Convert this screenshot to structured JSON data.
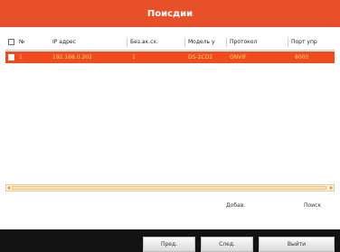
{
  "window": {
    "title": "Поисдии"
  },
  "table": {
    "columns": [
      "№",
      "IP адрес",
      "Без.ак.сх.",
      "Модель у",
      "Протокол",
      "Порт упр"
    ],
    "rows": [
      {
        "selected": true,
        "cells": [
          "1",
          "192.168.0.202",
          "1",
          "DS-2CD2",
          "ONVIF",
          "8000"
        ]
      }
    ]
  },
  "actions": {
    "add": "Добав.",
    "search": "Поиск"
  },
  "buttons": {
    "prev": "Пред.",
    "next": "След.",
    "exit": "Выйти"
  }
}
